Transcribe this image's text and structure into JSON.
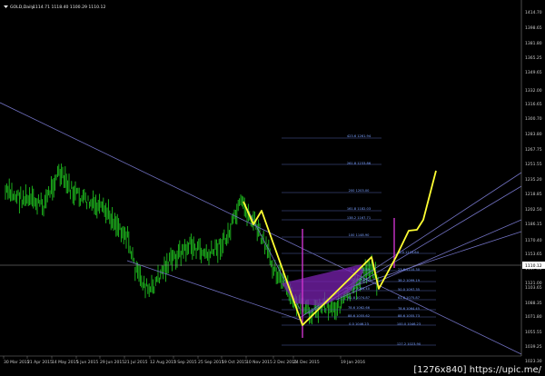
{
  "header": {
    "symbol_text": "GOLD,Daily",
    "ohlc_text": "1114.71 1118.40 1100.29 1110.12",
    "dropdown_icon": "triangle-down-icon"
  },
  "watermark": "[1276x840] https://upic.me/",
  "colors": {
    "background": "#000000",
    "candle": "#1fbf1f",
    "trendline": "#7070c0",
    "pattern_line": "#ffff33",
    "pattern_fill": "#7a22b0",
    "marker": "#cc33cc",
    "fib_text": "#7aa0ff",
    "current_price_line": "#9a9a9a",
    "current_price_box": "#ffffff"
  },
  "price_axis": {
    "labels": [
      "1414.70",
      "1398.65",
      "1381.80",
      "1365.25",
      "1349.65",
      "1332.00",
      "1316.65",
      "1300.70",
      "1283.80",
      "1267.75",
      "1251.55",
      "1235.20",
      "1218.85",
      "1202.50",
      "1186.15",
      "1170.40",
      "1153.65",
      "1137.30",
      "1121.00",
      "1110.12",
      "1103.65",
      "1088.35",
      "1071.80",
      "1055.55",
      "1039.25",
      "1023.30"
    ],
    "current_price": "1110.12"
  },
  "time_axis": {
    "labels": [
      "30 Mar 2015",
      "21 Apr 2015",
      "14 May 2015",
      "5 Jun 2015",
      "29 Jun 2015",
      "21 Jul 2015",
      "12 Aug 2015",
      "3 Sep 2015",
      "25 Sep 2015",
      "19 Oct 2015",
      "10 Nov 2015",
      "2 Dec 2015",
      "24 Dec 2015",
      "19 Jan 2016"
    ]
  },
  "fib_labels": [
    "423.6  1261.94",
    "261.8  1233.86",
    "200  1203.00",
    "161.8  1182.03",
    "138.2  1167.71",
    "100  1148.90",
    "0.0  1123.64",
    "23.6  1110.30",
    "38.2  1099.19",
    "50.0  1097.35",
    "61.8  1075.87",
    "78.6  1064.45",
    "88.6  1055.73",
    "100.0  1046.23",
    "127.2  1023.90",
    "23.6  1102.59",
    "38.2  1091.92",
    "50.0  1083.40",
    "61.8  1074.87",
    "78.6  1062.66",
    "88.6  1055.62",
    "0.0  1046.23"
  ]
}
